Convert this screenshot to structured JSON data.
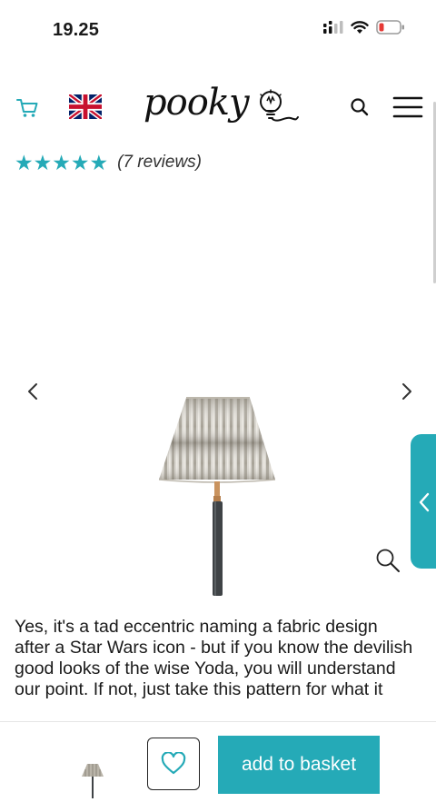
{
  "status_bar": {
    "time": "19.25",
    "icons": [
      "cellular-signal-icon",
      "wifi-icon",
      "battery-low-icon"
    ]
  },
  "header": {
    "logo_text": "pooky",
    "icons": [
      "cart-icon",
      "uk-flag-icon",
      "lightbulb-logo-icon",
      "search-icon",
      "hamburger-menu-icon"
    ]
  },
  "product": {
    "rating_stars": "★★★★★",
    "rating_value": 5,
    "reviews_label": "(7 reviews)",
    "description": "Yes, it's a tad eccentric naming a fabric design after a Star Wars icon - but if you know the devilish good looks of the wise Yoda, you will understand our point. If not, just take this pattern for what it"
  },
  "carousel": {
    "icons": [
      "chevron-left-icon",
      "chevron-right-icon",
      "zoom-icon"
    ]
  },
  "side_tab": {
    "icon": "chevron-left-icon"
  },
  "bottom_bar": {
    "basket_label": "add to basket",
    "icons": [
      "heart-icon"
    ]
  },
  "colors": {
    "accent": "#25aab7",
    "text": "#1a1a1a",
    "battery_low": "#e53935"
  }
}
